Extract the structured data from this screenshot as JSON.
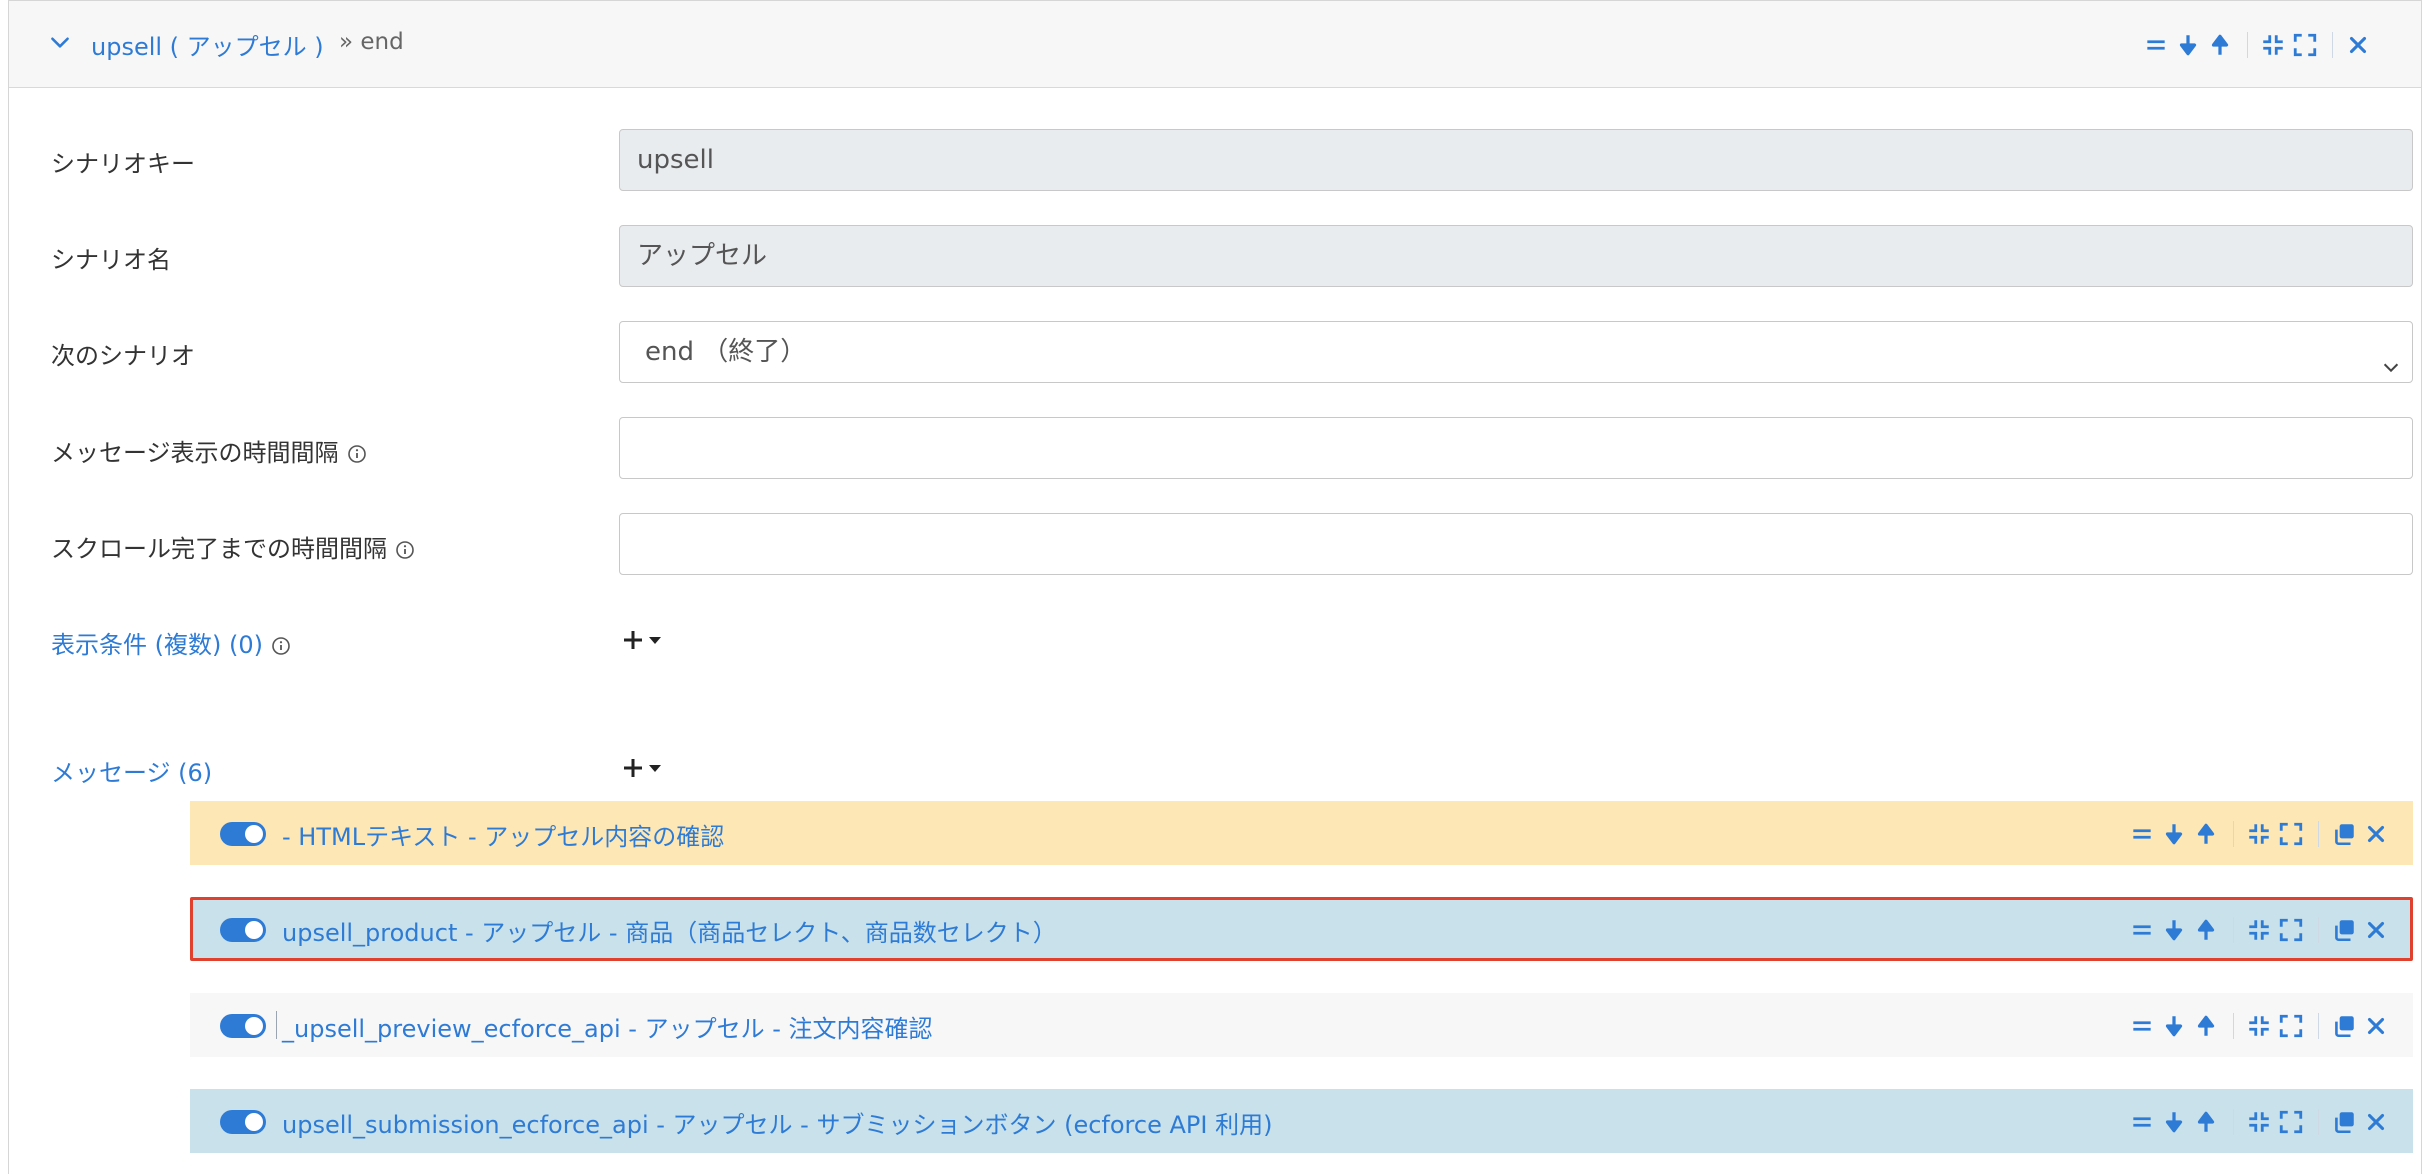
{
  "header": {
    "title": "upsell ( アップセル )",
    "next": "» end"
  },
  "form": {
    "scenario_key_label": "シナリオキー",
    "scenario_key_value": "upsell",
    "scenario_name_label": "シナリオ名",
    "scenario_name_value": "アップセル",
    "next_scenario_label": "次のシナリオ",
    "next_scenario_value": "end （終了）",
    "message_interval_label": "メッセージ表示の時間間隔",
    "message_interval_value": "",
    "scroll_interval_label": "スクロール完了までの時間間隔",
    "scroll_interval_value": "",
    "display_conditions_label": "表示条件 (複数) (0)",
    "messages_label": "メッセージ (6)"
  },
  "messages": [
    {
      "text": "- HTMLテキスト - アップセル内容の確認",
      "enabled": true,
      "highlight": "yellow"
    },
    {
      "text": "upsell_product - アップセル - 商品（商品セレクト、商品数セレクト）",
      "enabled": true,
      "highlight": "blue",
      "selected": true
    },
    {
      "text": "_upsell_preview_ecforce_api - アップセル - 注文内容確認",
      "enabled": true,
      "highlight": "gray"
    },
    {
      "text": "upsell_submission_ecforce_api - アップセル - サブミッションボタン (ecforce API 利用)",
      "enabled": true,
      "highlight": "blue"
    }
  ],
  "icons": {
    "collapse": "chevron-down-icon",
    "reorder": "drag-handle-icon",
    "move_down": "arrow-down-icon",
    "move_up": "arrow-up-icon",
    "shrink": "compress-icon",
    "expand": "expand-icon",
    "copy": "copy-icon",
    "close": "close-icon",
    "info": "info-icon",
    "add": "plus-dropdown-icon"
  },
  "colors": {
    "accent": "#2e7bd6",
    "yellow_row": "#fde7b5",
    "blue_row": "#c9e1ea",
    "selected_border": "#e0402e"
  }
}
